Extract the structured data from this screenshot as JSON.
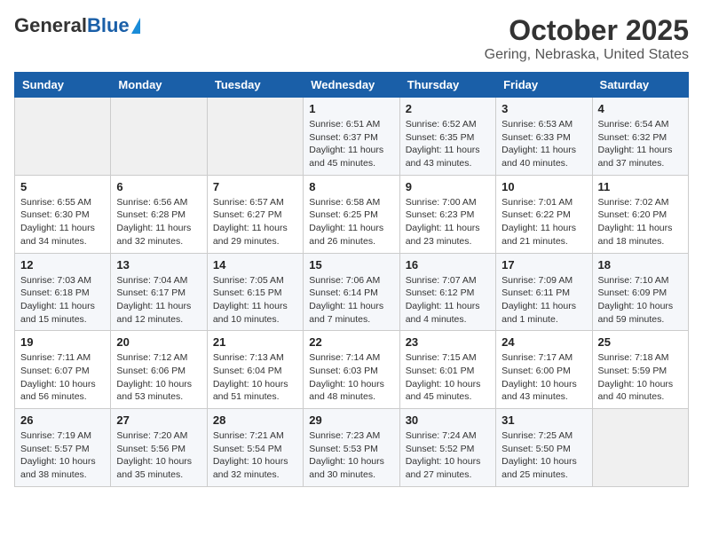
{
  "header": {
    "logo_general": "General",
    "logo_blue": "Blue",
    "month_title": "October 2025",
    "location": "Gering, Nebraska, United States"
  },
  "days_of_week": [
    "Sunday",
    "Monday",
    "Tuesday",
    "Wednesday",
    "Thursday",
    "Friday",
    "Saturday"
  ],
  "weeks": [
    [
      {
        "day": "",
        "info": ""
      },
      {
        "day": "",
        "info": ""
      },
      {
        "day": "",
        "info": ""
      },
      {
        "day": "1",
        "info": "Sunrise: 6:51 AM\nSunset: 6:37 PM\nDaylight: 11 hours\nand 45 minutes."
      },
      {
        "day": "2",
        "info": "Sunrise: 6:52 AM\nSunset: 6:35 PM\nDaylight: 11 hours\nand 43 minutes."
      },
      {
        "day": "3",
        "info": "Sunrise: 6:53 AM\nSunset: 6:33 PM\nDaylight: 11 hours\nand 40 minutes."
      },
      {
        "day": "4",
        "info": "Sunrise: 6:54 AM\nSunset: 6:32 PM\nDaylight: 11 hours\nand 37 minutes."
      }
    ],
    [
      {
        "day": "5",
        "info": "Sunrise: 6:55 AM\nSunset: 6:30 PM\nDaylight: 11 hours\nand 34 minutes."
      },
      {
        "day": "6",
        "info": "Sunrise: 6:56 AM\nSunset: 6:28 PM\nDaylight: 11 hours\nand 32 minutes."
      },
      {
        "day": "7",
        "info": "Sunrise: 6:57 AM\nSunset: 6:27 PM\nDaylight: 11 hours\nand 29 minutes."
      },
      {
        "day": "8",
        "info": "Sunrise: 6:58 AM\nSunset: 6:25 PM\nDaylight: 11 hours\nand 26 minutes."
      },
      {
        "day": "9",
        "info": "Sunrise: 7:00 AM\nSunset: 6:23 PM\nDaylight: 11 hours\nand 23 minutes."
      },
      {
        "day": "10",
        "info": "Sunrise: 7:01 AM\nSunset: 6:22 PM\nDaylight: 11 hours\nand 21 minutes."
      },
      {
        "day": "11",
        "info": "Sunrise: 7:02 AM\nSunset: 6:20 PM\nDaylight: 11 hours\nand 18 minutes."
      }
    ],
    [
      {
        "day": "12",
        "info": "Sunrise: 7:03 AM\nSunset: 6:18 PM\nDaylight: 11 hours\nand 15 minutes."
      },
      {
        "day": "13",
        "info": "Sunrise: 7:04 AM\nSunset: 6:17 PM\nDaylight: 11 hours\nand 12 minutes."
      },
      {
        "day": "14",
        "info": "Sunrise: 7:05 AM\nSunset: 6:15 PM\nDaylight: 11 hours\nand 10 minutes."
      },
      {
        "day": "15",
        "info": "Sunrise: 7:06 AM\nSunset: 6:14 PM\nDaylight: 11 hours\nand 7 minutes."
      },
      {
        "day": "16",
        "info": "Sunrise: 7:07 AM\nSunset: 6:12 PM\nDaylight: 11 hours\nand 4 minutes."
      },
      {
        "day": "17",
        "info": "Sunrise: 7:09 AM\nSunset: 6:11 PM\nDaylight: 11 hours\nand 1 minute."
      },
      {
        "day": "18",
        "info": "Sunrise: 7:10 AM\nSunset: 6:09 PM\nDaylight: 10 hours\nand 59 minutes."
      }
    ],
    [
      {
        "day": "19",
        "info": "Sunrise: 7:11 AM\nSunset: 6:07 PM\nDaylight: 10 hours\nand 56 minutes."
      },
      {
        "day": "20",
        "info": "Sunrise: 7:12 AM\nSunset: 6:06 PM\nDaylight: 10 hours\nand 53 minutes."
      },
      {
        "day": "21",
        "info": "Sunrise: 7:13 AM\nSunset: 6:04 PM\nDaylight: 10 hours\nand 51 minutes."
      },
      {
        "day": "22",
        "info": "Sunrise: 7:14 AM\nSunset: 6:03 PM\nDaylight: 10 hours\nand 48 minutes."
      },
      {
        "day": "23",
        "info": "Sunrise: 7:15 AM\nSunset: 6:01 PM\nDaylight: 10 hours\nand 45 minutes."
      },
      {
        "day": "24",
        "info": "Sunrise: 7:17 AM\nSunset: 6:00 PM\nDaylight: 10 hours\nand 43 minutes."
      },
      {
        "day": "25",
        "info": "Sunrise: 7:18 AM\nSunset: 5:59 PM\nDaylight: 10 hours\nand 40 minutes."
      }
    ],
    [
      {
        "day": "26",
        "info": "Sunrise: 7:19 AM\nSunset: 5:57 PM\nDaylight: 10 hours\nand 38 minutes."
      },
      {
        "day": "27",
        "info": "Sunrise: 7:20 AM\nSunset: 5:56 PM\nDaylight: 10 hours\nand 35 minutes."
      },
      {
        "day": "28",
        "info": "Sunrise: 7:21 AM\nSunset: 5:54 PM\nDaylight: 10 hours\nand 32 minutes."
      },
      {
        "day": "29",
        "info": "Sunrise: 7:23 AM\nSunset: 5:53 PM\nDaylight: 10 hours\nand 30 minutes."
      },
      {
        "day": "30",
        "info": "Sunrise: 7:24 AM\nSunset: 5:52 PM\nDaylight: 10 hours\nand 27 minutes."
      },
      {
        "day": "31",
        "info": "Sunrise: 7:25 AM\nSunset: 5:50 PM\nDaylight: 10 hours\nand 25 minutes."
      },
      {
        "day": "",
        "info": ""
      }
    ]
  ]
}
